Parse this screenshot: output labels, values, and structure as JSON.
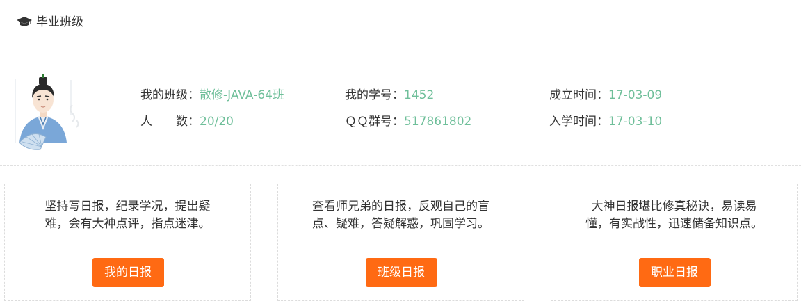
{
  "header": {
    "title": "毕业班级",
    "icon": "graduation-cap-icon"
  },
  "class_info": {
    "avatar": "scholar-avatar",
    "my_class": {
      "label": "我的班级：",
      "value": "散修-JAVA-64班"
    },
    "count": {
      "label": "人　　数：",
      "value": "20/20"
    },
    "student_no": {
      "label": "我的学号：",
      "value": "1452"
    },
    "qq_group": {
      "label": "ＱＱ群号：",
      "value": "517861802"
    },
    "founded": {
      "label": "成立时间：",
      "value": "17-03-09"
    },
    "enrolled": {
      "label": "入学时间：",
      "value": "17-03-10"
    }
  },
  "cards": [
    {
      "line1": "坚持写日报，纪录学况，提出疑",
      "line2": "难，会有大神点评，指点迷津。",
      "button": "我的日报"
    },
    {
      "line1": "查看师兄弟的日报，反观自己的盲",
      "line2": "点、疑难，答疑解惑，巩固学习。",
      "button": "班级日报"
    },
    {
      "line1": "大神日报堪比修真秘诀，易读易",
      "line2": "懂，有实战性，迅速储备知识点。",
      "button": "职业日报"
    }
  ],
  "colors": {
    "accent": "#ff6a13",
    "value_text": "#6fbf9a",
    "label_text": "#333333"
  }
}
